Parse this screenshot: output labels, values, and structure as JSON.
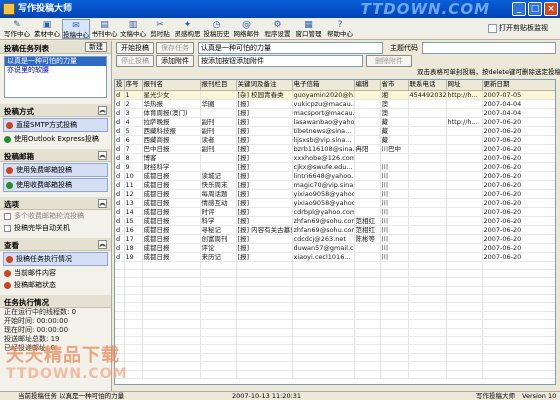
{
  "window": {
    "title": "写作投稿大师",
    "watermark_top": "TTDOWN.COM"
  },
  "toolbar": {
    "buttons": [
      "写作中心",
      "素材中心",
      "投稿中心",
      "书刊中心",
      "文稿中心",
      "剪时贴",
      "灵感构思",
      "投稿历史",
      "网络邮件",
      "程序设置",
      "窗口管理",
      "帮助中心"
    ],
    "icons": [
      "pen-icon",
      "folder-icon",
      "send-icon",
      "book-icon",
      "doc-icon",
      "clip-icon",
      "idea-icon",
      "history-icon",
      "mail-icon",
      "gear-icon",
      "window-icon",
      "help-icon"
    ],
    "active_index": 2,
    "clipboard_check": "打开剪贴板监视"
  },
  "left": {
    "task_title": "投稿任务列表",
    "new_label": "新建",
    "tasks": [
      "以真是一种可怕的力量",
      "亦说里的软腰"
    ],
    "method_title": "投稿方式",
    "methods": [
      "直接SMTP方式投稿",
      "使用Outlook Express投稿"
    ],
    "mailbox_title": "投稿邮箱",
    "mailboxes": [
      "使用免费邮箱投稿",
      "使用收费邮箱投稿"
    ],
    "options_title": "选项",
    "options": [
      "多个收费邮箱轮流投稿",
      "投稿完毕自动关机"
    ],
    "view_title": "查看",
    "views": [
      "投稿任务执行情况",
      "当前邮件内容",
      "投稿邮箱状态"
    ],
    "exec_title": "任务执行情况",
    "stats": [
      "正在运行中的线程数: 0",
      "开始时间: 00:00:00",
      "现在时间: 00:00:00",
      "",
      "投送邮址总数: 19",
      "已经投递邮址: 0"
    ]
  },
  "main": {
    "start_btn": "开始投稿",
    "save_btn": "保存任务",
    "subject": "认真是一种可怕的力量",
    "theme_label": "主题代码",
    "stop_btn": "停止投稿",
    "attach_btn": "添加附件",
    "attach_hint": "按添加按钮添加附件",
    "del_attach_btn": "删除附件",
    "tip": "双击表格可单封投稿，按delete键可删除选定投稿地址。"
  },
  "grid": {
    "columns": [
      "投",
      "序号",
      "报刊名",
      "报刊栏目",
      "关键词及备注",
      "电子信箱",
      "编辑",
      "省市",
      "联系电话",
      "网址",
      "更新日期"
    ],
    "rows": [
      [
        "d",
        "1",
        "星光少女",
        "",
        "[杂] 校园青春类",
        "guoyamin2020@h...",
        "",
        "湘",
        "454492032",
        "http://h...",
        "2007-07-05"
      ],
      [
        "d",
        "2",
        "华热报",
        "华圈",
        "[报]",
        "vukicpzu@macau...",
        "",
        "澳",
        "",
        "",
        "2007-04-04"
      ],
      [
        "d",
        "3",
        "体育周报(澳门)",
        "",
        "[报]",
        "macsport@macau...",
        "",
        "澳",
        "",
        "",
        "2007-04-04"
      ],
      [
        "d",
        "4",
        "拉萨晚报",
        "副刊",
        "[报]",
        "lasawanbao@yaho...",
        "",
        "藏",
        "",
        "http://h...",
        "2007-06-20"
      ],
      [
        "d",
        "5",
        "西藏科技报",
        "副刊",
        "[报]",
        "tibetnews@sina...",
        "",
        "藏",
        "",
        "",
        "2007-06-20"
      ],
      [
        "d",
        "6",
        "西藏商报",
        "读者",
        "[报]",
        "lijsxsb@vip.sina...",
        "",
        "藏",
        "",
        "",
        "2007-06-20"
      ],
      [
        "d",
        "7",
        "巴中日报",
        "副刊",
        "[报]",
        "bzrb116108@sina...",
        "冉阳",
        "川巴中",
        "",
        "",
        "2007-06-20"
      ],
      [
        "d",
        "8",
        "博客",
        "",
        "[报]",
        "xxxhobe@126.com",
        "",
        "",
        "",
        "",
        "2007-06-20"
      ],
      [
        "d",
        "9",
        "财经科学",
        "",
        "[报]",
        "cjkx@swufe.edu...",
        "",
        "川",
        "",
        "",
        "2007-06-20"
      ],
      [
        "d",
        "10",
        "成都日报",
        "读城记",
        "[报]",
        "lintri6648@yahoo...",
        "",
        "川",
        "",
        "",
        "2007-06-20"
      ],
      [
        "d",
        "11",
        "成都日报",
        "快乐周末",
        "[报]",
        "magic70@vip.sina...",
        "",
        "川",
        "",
        "",
        "2007-06-20"
      ],
      [
        "d",
        "12",
        "成都日报",
        "每周话题",
        "[报]",
        "yixiao9058@yahoo...",
        "",
        "川",
        "",
        "",
        "2007-06-20"
      ],
      [
        "d",
        "13",
        "成都日报",
        "情感互动",
        "[报]",
        "yixiao9058@yahoo...",
        "",
        "川",
        "",
        "",
        "2007-06-20"
      ],
      [
        "d",
        "14",
        "成都日报",
        "时评",
        "[报]",
        "cdrbpl@yahoo.com...",
        "",
        "川",
        "",
        "",
        "2007-06-20"
      ],
      [
        "d",
        "15",
        "成都日报",
        "科学",
        "[报]",
        "zhfan69@sohu.com",
        "范相红",
        "川",
        "",
        "",
        "2007-06-20"
      ],
      [
        "d",
        "16",
        "成都日报",
        "寻秘记",
        "[报] 内容有关古墓葬",
        "zhfan69@sohu.com",
        "范相红",
        "川",
        "",
        "",
        "2007-06-20"
      ],
      [
        "d",
        "17",
        "成都日报",
        "创富周刊",
        "[报]",
        "cdcdcj@263.net",
        "陈彬等",
        "川",
        "",
        "",
        "2007-06-20"
      ],
      [
        "d",
        "18",
        "成都日报",
        "评论",
        "[报]",
        "duwan57@gmail.com",
        "",
        "川",
        "",
        "",
        "2007-06-20"
      ],
      [
        "d",
        "19",
        "成都日报",
        "来历记",
        "[报]",
        "xiaoyi.cecl1016...",
        "",
        "川",
        "",
        "",
        "2007-06-20"
      ],
      [
        "",
        "",
        "",
        "",
        "",
        "",
        "",
        "",
        "",
        "",
        ""
      ],
      [
        "",
        "",
        "",
        "",
        "",
        "",
        "",
        "",
        "",
        "",
        ""
      ],
      [
        "",
        "",
        "",
        "",
        "",
        "",
        "",
        "",
        "",
        "",
        ""
      ],
      [
        "",
        "",
        "",
        "",
        "",
        "",
        "",
        "",
        "",
        "",
        ""
      ],
      [
        "",
        "",
        "",
        "",
        "",
        "",
        "",
        "",
        "",
        "",
        ""
      ],
      [
        "",
        "",
        "",
        "",
        "",
        "",
        "",
        "",
        "",
        "",
        ""
      ],
      [
        "",
        "",
        "",
        "",
        "",
        "",
        "",
        "",
        "",
        "",
        ""
      ],
      [
        "",
        "",
        "",
        "",
        "",
        "",
        "",
        "",
        "",
        "",
        ""
      ],
      [
        "",
        "",
        "",
        "",
        "",
        "",
        "",
        "",
        "",
        "",
        ""
      ],
      [
        "",
        "",
        "",
        "",
        "",
        "",
        "",
        "",
        "",
        "",
        ""
      ],
      [
        "",
        "",
        "",
        "",
        "",
        "",
        "",
        "",
        "",
        "",
        ""
      ],
      [
        "",
        "",
        "",
        "",
        "",
        "",
        "",
        "",
        "",
        "",
        ""
      ],
      [
        "",
        "",
        "",
        "",
        "",
        "",
        "",
        "",
        "",
        "",
        ""
      ],
      [
        "",
        "",
        "",
        "",
        "",
        "",
        "",
        "",
        "",
        "",
        ""
      ]
    ]
  },
  "status": {
    "task": "当前投稿任务 以真是一种可怕的力量",
    "time": "2007-10-13 11:20:31",
    "app": "写作投稿大师",
    "version": "Version 10"
  },
  "watermark": {
    "line1": "天天精品下载",
    "line2": "TTDOWN.COM"
  }
}
